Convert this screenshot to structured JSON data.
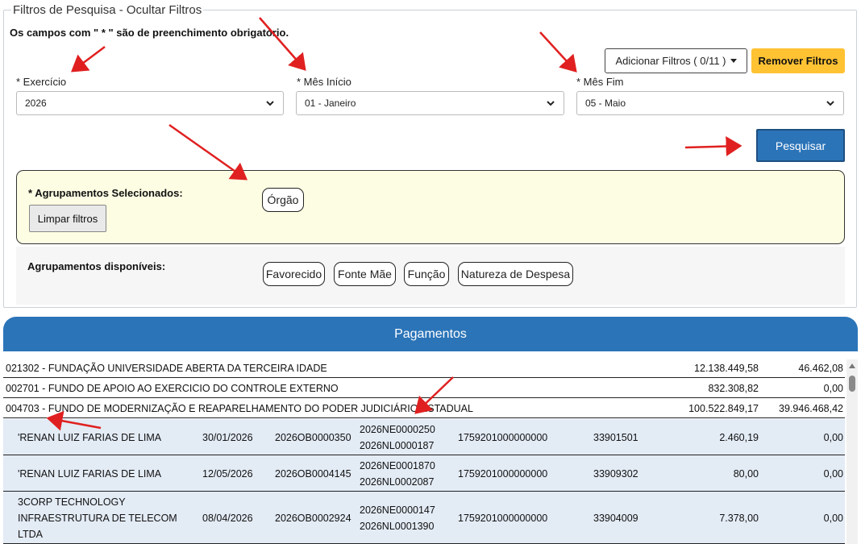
{
  "filters": {
    "legend": "Filtros de Pesquisa - Ocultar Filtros",
    "required_note": "Os campos com \" * \" são de preenchimento obrigatório.",
    "add_filters_label": "Adicionar Filtros ( 0/11 )",
    "remove_filters_label": "Remover Filtros",
    "exercicio": {
      "label": "* Exercício",
      "value": "2026"
    },
    "mes_inicio": {
      "label": "* Mês Início",
      "value": "01 - Janeiro"
    },
    "mes_fim": {
      "label": "* Mês Fim",
      "value": "05 - Maio"
    },
    "search_label": "Pesquisar"
  },
  "groupings": {
    "selected_title": "* Agrupamentos Selecionados:",
    "clear_label": "Limpar filtros",
    "selected": [
      "Órgão"
    ],
    "available_title": "Agrupamentos disponíveis:",
    "available": [
      "Favorecido",
      "Fonte Mãe",
      "Função",
      "Natureza de Despesa"
    ]
  },
  "payments": {
    "title": "Pagamentos",
    "org_rows": [
      {
        "name": "021302 - FUNDAÇÃO UNIVERSIDADE ABERTA DA TERCEIRA IDADE",
        "v1": "12.138.449,58",
        "v2": "46.462,08"
      },
      {
        "name": "002701 - FUNDO DE APOIO AO EXERCICIO DO CONTROLE EXTERNO",
        "v1": "832.308,82",
        "v2": "0,00"
      },
      {
        "name": "004703 - FUNDO DE MODERNIZAÇÃO E REAPARELHAMENTO DO PODER JUDICIÁRIO ESTADUAL",
        "v1": "100.522.849,17",
        "v2": "39.946.468,42"
      }
    ],
    "detail_rows": [
      {
        "favorecido": [
          "'RENAN LUIZ FARIAS DE LIMA"
        ],
        "data": "30/01/2026",
        "ob": "2026OB0000350",
        "ne": "2026NE0000250",
        "nl": "2026NL0000187",
        "fonte": "1759201000000000",
        "natureza": "33901501",
        "v1": "2.460,19",
        "v2": "0,00"
      },
      {
        "favorecido": [
          "'RENAN LUIZ FARIAS DE LIMA"
        ],
        "data": "12/05/2026",
        "ob": "2026OB0004145",
        "ne": "2026NE0001870",
        "nl": "2026NL0002087",
        "fonte": "1759201000000000",
        "natureza": "33909302",
        "v1": "80,00",
        "v2": "0,00"
      },
      {
        "favorecido": [
          "3CORP TECHNOLOGY",
          "INFRAESTRUTURA DE TELECOM",
          "LTDA"
        ],
        "data": "08/04/2026",
        "ob": "2026OB0002924",
        "ne": "2026NE0000147",
        "nl": "2026NL0001390",
        "fonte": "1759201000000000",
        "natureza": "33904009",
        "v1": "7.378,00",
        "v2": "0,00"
      }
    ]
  },
  "colors": {
    "primary_blue": "#2b74b8",
    "warning_yellow": "#ffc233",
    "selected_panel": "#fdfde3",
    "detail_row": "#e3ebf5",
    "annotation_red": "#e02020"
  }
}
